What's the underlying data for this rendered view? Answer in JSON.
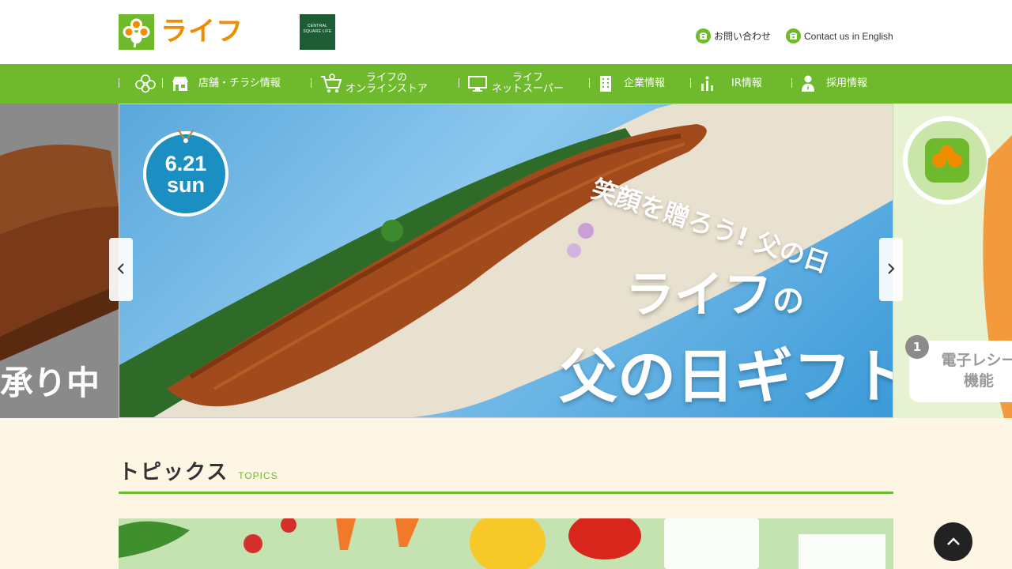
{
  "header": {
    "logo_text": "ライフ",
    "cs_logo_text": "CENTRAL SQUARE LIFE",
    "contact_label": "お問い合わせ",
    "english_label": "Contact us in English"
  },
  "nav": {
    "items": [
      {
        "label": ""
      },
      {
        "label": "店舗・チラシ情報"
      },
      {
        "label_line1": "ライフの",
        "label_line2": "オンラインストア"
      },
      {
        "label_line1": "ライフ",
        "label_line2": "ネットスーパー"
      },
      {
        "label": "企業情報"
      },
      {
        "label": "IR情報"
      },
      {
        "label": "採用情報"
      }
    ]
  },
  "carousel": {
    "main": {
      "date_line1": "6.21",
      "date_line2": "sun",
      "tagline": "笑顔を贈ろう! 父の日",
      "title_line1": "ライフ",
      "title_particle": "の",
      "title_line2": "父の日ギフト"
    },
    "prev": {
      "text": "承り中"
    },
    "next": {
      "num": "1",
      "line1": "電子レシー",
      "line2": "機能"
    }
  },
  "topics": {
    "title": "トピックス",
    "subtitle": "TOPICS"
  },
  "colors": {
    "brand_green": "#6fb92c",
    "brand_orange": "#f08c00",
    "background": "#fdf6e5"
  }
}
